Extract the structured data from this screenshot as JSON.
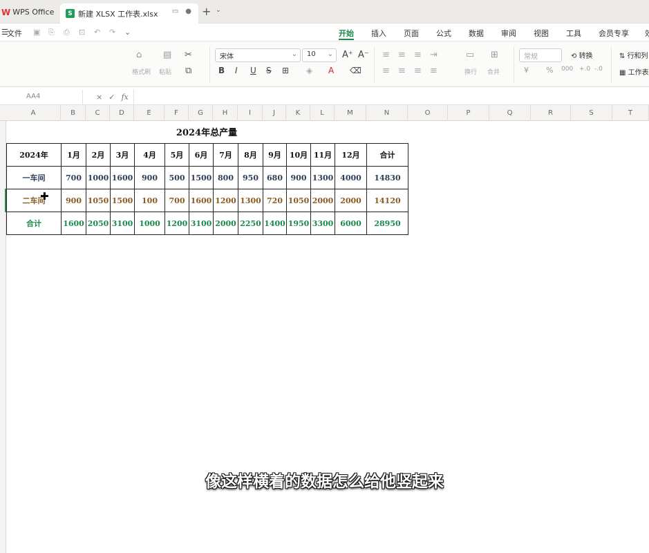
{
  "tabs": {
    "wps": "WPS Office",
    "doc": "新建 XLSX 工作表.xlsx",
    "doc_badge": "S"
  },
  "menu": {
    "file": "文件",
    "items": [
      "开始",
      "插入",
      "页面",
      "公式",
      "数据",
      "审阅",
      "视图",
      "工具",
      "会员专享",
      "效"
    ],
    "active": "开始"
  },
  "ribbon": {
    "format_painter": "格式刷",
    "paste": "粘贴",
    "font_name": "宋体",
    "font_size": "10",
    "bold": "B",
    "italic": "I",
    "underline": "U",
    "wrap": "换行",
    "merge": "合并",
    "number_format": "常规",
    "convert": "转换",
    "row_col": "行和列",
    "worksheet": "工作表"
  },
  "formula_bar": {
    "cell_ref": "AA4",
    "cancel": "×",
    "confirm": "✓",
    "fx": "fx"
  },
  "columns": [
    "A",
    "B",
    "C",
    "D",
    "E",
    "F",
    "G",
    "H",
    "I",
    "J",
    "K",
    "L",
    "M",
    "N",
    "O",
    "P",
    "Q",
    "R",
    "S",
    "T"
  ],
  "sheet": {
    "title": "2024年总产量",
    "header": [
      "2024年",
      "1月",
      "2月",
      "3月",
      "4月",
      "5月",
      "6月",
      "7月",
      "8月",
      "9月",
      "10月",
      "11月",
      "12月",
      "合计"
    ],
    "rows": [
      [
        "一车间",
        "700",
        "1000",
        "1600",
        "900",
        "500",
        "1500",
        "800",
        "950",
        "680",
        "900",
        "1300",
        "4000",
        "14830"
      ],
      [
        "二车间",
        "900",
        "1050",
        "1500",
        "100",
        "700",
        "1600",
        "1200",
        "1300",
        "720",
        "1050",
        "2000",
        "2000",
        "14120"
      ],
      [
        "合计",
        "1600",
        "2050",
        "3100",
        "1000",
        "1200",
        "3100",
        "2000",
        "2250",
        "1400",
        "1950",
        "3300",
        "6000",
        "28950"
      ]
    ]
  },
  "subtitle": "像这样横着的数据怎么给他竖起来",
  "colors": {
    "accent": "#1a8a4a",
    "row1": "#2b3f58",
    "row2": "#8a5a20",
    "sum": "#1a8a4a"
  }
}
